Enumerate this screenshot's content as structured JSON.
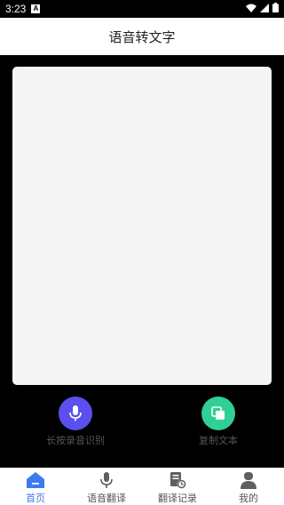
{
  "status_bar": {
    "time": "3:23",
    "badge": "A"
  },
  "header": {
    "title": "语音转文字"
  },
  "actions": {
    "record": {
      "label": "长按录音识别",
      "color": "#5b4ff0"
    },
    "copy": {
      "label": "复制文本",
      "color": "#2fcf95"
    }
  },
  "tabbar": {
    "items": [
      {
        "label": "首页",
        "icon": "home-icon",
        "active": true
      },
      {
        "label": "语音翻译",
        "icon": "microphone-icon",
        "active": false
      },
      {
        "label": "翻译记录",
        "icon": "history-icon",
        "active": false
      },
      {
        "label": "我的",
        "icon": "user-icon",
        "active": false
      }
    ]
  },
  "colors": {
    "accent": "#3a7bf0",
    "icon_gray": "#5f5f5f"
  }
}
